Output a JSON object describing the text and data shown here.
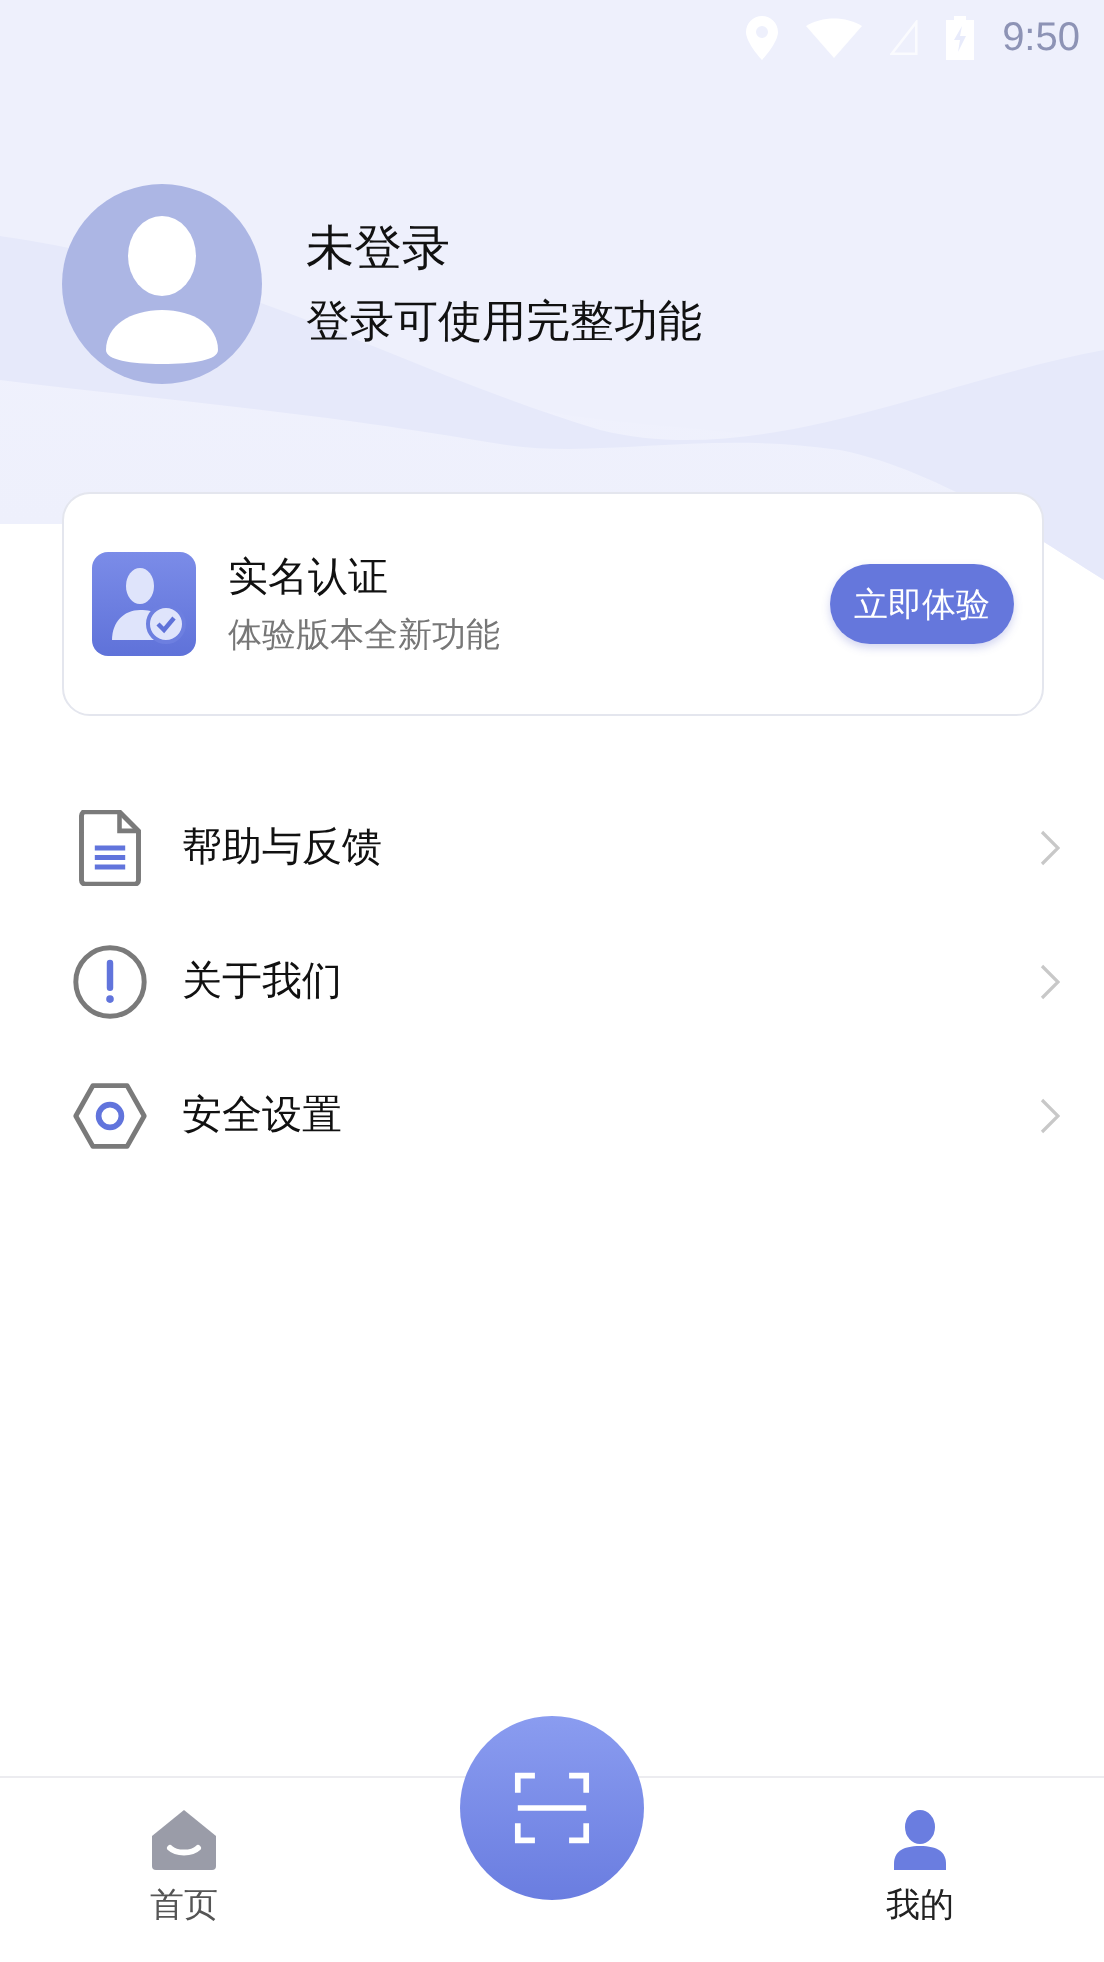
{
  "status_bar": {
    "time": "9:50"
  },
  "profile": {
    "name": "未登录",
    "subtitle": "登录可使用完整功能"
  },
  "verify_card": {
    "title": "实名认证",
    "subtitle": "体验版本全新功能",
    "button": "立即体验"
  },
  "menu": [
    {
      "kind": "document",
      "label": "帮助与反馈"
    },
    {
      "kind": "info",
      "label": "关于我们"
    },
    {
      "kind": "settings",
      "label": "安全设置"
    }
  ],
  "tabs": [
    {
      "kind": "home",
      "label": "首页",
      "selected": false
    },
    {
      "kind": "scan"
    },
    {
      "kind": "profile",
      "label": "我的",
      "selected": true
    }
  ]
}
